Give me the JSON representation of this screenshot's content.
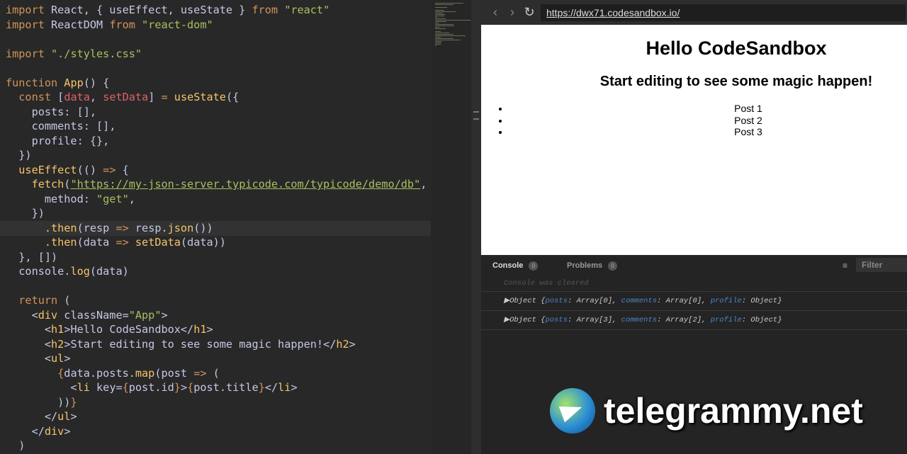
{
  "editor": {
    "highlighted_line": 15,
    "lines": [
      [
        [
          "kw",
          "import"
        ],
        [
          "id",
          " React, { useEffect, useState } "
        ],
        [
          "kw",
          "from"
        ],
        [
          "str",
          " \"react\""
        ]
      ],
      [
        [
          "kw",
          "import"
        ],
        [
          "id",
          " ReactDOM "
        ],
        [
          "kw",
          "from"
        ],
        [
          "str",
          " \"react-dom\""
        ]
      ],
      [],
      [
        [
          "kw",
          "import"
        ],
        [
          "str",
          " \"./styles.css\""
        ]
      ],
      [],
      [
        [
          "kw",
          "function"
        ],
        [
          "fn",
          " App"
        ],
        [
          "pl",
          "() {"
        ]
      ],
      [
        [
          "kw",
          "  const"
        ],
        [
          "pl",
          " ["
        ],
        [
          "var",
          "data"
        ],
        [
          "pl",
          ", "
        ],
        [
          "var",
          "setData"
        ],
        [
          "pl",
          "] "
        ],
        [
          "kw",
          "="
        ],
        [
          "fn",
          " useState"
        ],
        [
          "pl",
          "({"
        ]
      ],
      [
        [
          "pl",
          "    posts: [],"
        ]
      ],
      [
        [
          "pl",
          "    comments: [],"
        ]
      ],
      [
        [
          "pl",
          "    profile: {},"
        ]
      ],
      [
        [
          "pl",
          "  })"
        ]
      ],
      [
        [
          "fn",
          "  useEffect"
        ],
        [
          "pl",
          "(() "
        ],
        [
          "kw",
          "=>"
        ],
        [
          "pl",
          " {"
        ]
      ],
      [
        [
          "fn",
          "    fetch"
        ],
        [
          "pl",
          "("
        ],
        [
          "url",
          "\"https://my-json-server.typicode.com/typicode/demo/db\""
        ],
        [
          "pl",
          ", {"
        ]
      ],
      [
        [
          "pl",
          "      method: "
        ],
        [
          "str",
          "\"get\""
        ],
        [
          "pl",
          ","
        ]
      ],
      [
        [
          "pl",
          "    })"
        ]
      ],
      [
        [
          "fn",
          "      .then"
        ],
        [
          "pl",
          "(resp "
        ],
        [
          "kw",
          "=>"
        ],
        [
          "pl",
          " resp."
        ],
        [
          "fn",
          "json"
        ],
        [
          "pl",
          "())"
        ]
      ],
      [
        [
          "fn",
          "      .then"
        ],
        [
          "pl",
          "(data "
        ],
        [
          "kw",
          "=>"
        ],
        [
          "fn",
          " setData"
        ],
        [
          "pl",
          "(data))"
        ]
      ],
      [
        [
          "pl",
          "  }, [])"
        ]
      ],
      [
        [
          "pl",
          "  console."
        ],
        [
          "fn",
          "log"
        ],
        [
          "pl",
          "(data)"
        ]
      ],
      [],
      [
        [
          "kw",
          "  return"
        ],
        [
          "pl",
          " ("
        ]
      ],
      [
        [
          "pl",
          "    <"
        ],
        [
          "tag",
          "div"
        ],
        [
          "pl",
          " className="
        ],
        [
          "str",
          "\"App\""
        ],
        [
          "pl",
          ">"
        ]
      ],
      [
        [
          "pl",
          "      <"
        ],
        [
          "tag",
          "h1"
        ],
        [
          "pl",
          ">Hello CodeSandbox</"
        ],
        [
          "tag",
          "h1"
        ],
        [
          "pl",
          ">"
        ]
      ],
      [
        [
          "pl",
          "      <"
        ],
        [
          "tag",
          "h2"
        ],
        [
          "pl",
          ">Start editing to see some magic happen!</"
        ],
        [
          "tag",
          "h2"
        ],
        [
          "pl",
          ">"
        ]
      ],
      [
        [
          "pl",
          "      <"
        ],
        [
          "tag",
          "ul"
        ],
        [
          "pl",
          ">"
        ]
      ],
      [
        [
          "kw",
          "        {"
        ],
        [
          "pl",
          "data.posts."
        ],
        [
          "fn",
          "map"
        ],
        [
          "pl",
          "(post "
        ],
        [
          "kw",
          "=>"
        ],
        [
          "pl",
          " ("
        ]
      ],
      [
        [
          "pl",
          "          <"
        ],
        [
          "tag",
          "li"
        ],
        [
          "pl",
          " key="
        ],
        [
          "kw",
          "{"
        ],
        [
          "pl",
          "post.id"
        ],
        [
          "kw",
          "}"
        ],
        [
          "pl",
          ">"
        ],
        [
          "kw",
          "{"
        ],
        [
          "pl",
          "post.title"
        ],
        [
          "kw",
          "}"
        ],
        [
          "pl",
          "</"
        ],
        [
          "tag",
          "li"
        ],
        [
          "pl",
          ">"
        ]
      ],
      [
        [
          "pl",
          "        ))"
        ],
        [
          "kw",
          "}"
        ]
      ],
      [
        [
          "pl",
          "      </"
        ],
        [
          "tag",
          "ul"
        ],
        [
          "pl",
          ">"
        ]
      ],
      [
        [
          "pl",
          "    </"
        ],
        [
          "tag",
          "div"
        ],
        [
          "pl",
          ">"
        ]
      ],
      [
        [
          "pl",
          "  )"
        ]
      ]
    ]
  },
  "browser": {
    "back": "‹",
    "forward": "›",
    "reload": "↻",
    "url": "https://dwx71.codesandbox.io/",
    "h1": "Hello CodeSandbox",
    "h2": "Start editing to see some magic happen!",
    "posts": [
      "Post 1",
      "Post 2",
      "Post 3"
    ]
  },
  "console": {
    "tabs": [
      {
        "label": "Console",
        "count": "0"
      },
      {
        "label": "Problems",
        "count": "0"
      }
    ],
    "filter_placeholder": "Filter",
    "menu_icon": "≡",
    "cleared": "Console was cleared",
    "entries": [
      {
        "arrow": "▶",
        "prefix": "Object {",
        "posts_key": "posts",
        "posts_val": ": Array[0], ",
        "comments_key": "comments",
        "comments_val": ": Array[0], ",
        "profile_key": "profile",
        "profile_val": ": Object}"
      },
      {
        "arrow": "▶",
        "prefix": "Object {",
        "posts_key": "posts",
        "posts_val": ": Array[3], ",
        "comments_key": "comments",
        "comments_val": ": Array[2], ",
        "profile_key": "profile",
        "profile_val": ": Object}"
      }
    ]
  },
  "watermark": {
    "text": "telegrammy.net"
  }
}
